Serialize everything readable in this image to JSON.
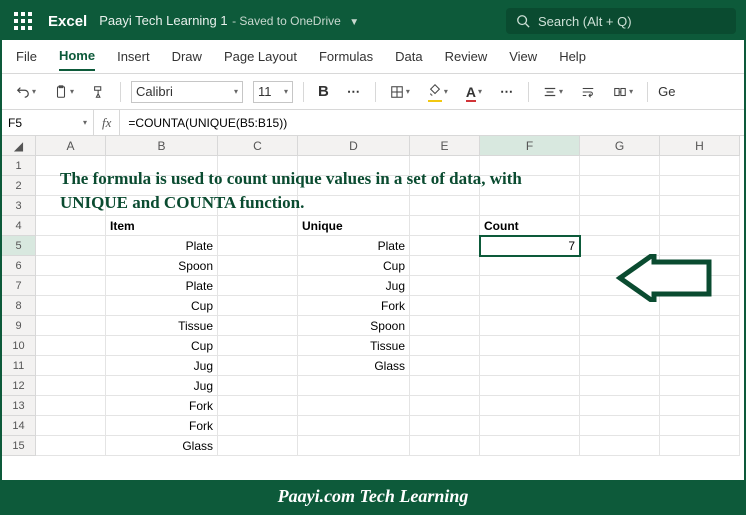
{
  "titlebar": {
    "app": "Excel",
    "doc": "Paayi Tech Learning 1",
    "saved": "- Saved to OneDrive",
    "search_placeholder": "Search (Alt + Q)"
  },
  "menu": {
    "tabs": [
      "File",
      "Home",
      "Insert",
      "Draw",
      "Page Layout",
      "Formulas",
      "Data",
      "Review",
      "View",
      "Help"
    ],
    "active": 1
  },
  "toolbar": {
    "font": "Calibri",
    "size": "11",
    "ge": "Ge"
  },
  "namebox": {
    "ref": "F5",
    "fx": "fx",
    "formula": "=COUNTA(UNIQUE(B5:B15))"
  },
  "banner": "The formula is used to count unique values in a set of data, with UNIQUE and COUNTA function.",
  "cols": [
    "A",
    "B",
    "C",
    "D",
    "E",
    "F",
    "G",
    "H"
  ],
  "rows": [
    "1",
    "2",
    "3",
    "4",
    "5",
    "6",
    "7",
    "8",
    "9",
    "10",
    "11",
    "12",
    "13",
    "14",
    "15"
  ],
  "headers": {
    "item": "Item",
    "unique": "Unique",
    "count": "Count"
  },
  "items": [
    "Plate",
    "Spoon",
    "Plate",
    "Cup",
    "Tissue",
    "Cup",
    "Jug",
    "Jug",
    "Fork",
    "Fork",
    "Glass"
  ],
  "unique": [
    "Plate",
    "Cup",
    "Jug",
    "Fork",
    "Spoon",
    "Tissue",
    "Glass"
  ],
  "count": "7",
  "footer": "Paayi.com Tech Learning"
}
